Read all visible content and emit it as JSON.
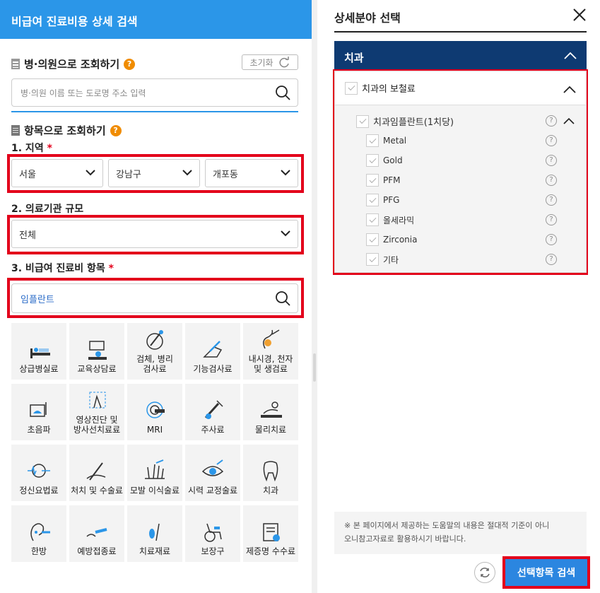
{
  "left": {
    "header_title": "비급여 진료비용 상세 검색",
    "hospital_search": {
      "title": "병·의원으로 조회하기",
      "help": "?",
      "reset_label": "초기화",
      "placeholder": "병·의원 이름 또는 도로명 주소 입력"
    },
    "item_search": {
      "title": "항목으로 조회하기",
      "help": "?",
      "region": {
        "label": "1. 지역",
        "required": "*",
        "sido": "서울",
        "sigungu": "강남구",
        "dong": "개포동"
      },
      "scale": {
        "label": "2. 의료기관 규모",
        "value": "전체"
      },
      "item": {
        "label": "3. 비급여 진료비 항목",
        "required": "*",
        "value": "임플란트"
      }
    },
    "categories": [
      {
        "l1": "상급병실료",
        "l2": "",
        "icon": "hospital-bed-icon"
      },
      {
        "l1": "교육상담료",
        "l2": "",
        "icon": "consultation-icon"
      },
      {
        "l1": "검체, 병리",
        "l2": "검사료",
        "icon": "specimen-icon"
      },
      {
        "l1": "기능검사료",
        "l2": "",
        "icon": "function-test-icon"
      },
      {
        "l1": "내시경, 천자",
        "l2": "및 생검료",
        "icon": "endoscope-icon"
      },
      {
        "l1": "초음파",
        "l2": "",
        "icon": "ultrasound-icon"
      },
      {
        "l1": "영상진단 및",
        "l2": "방사선치료료",
        "icon": "xray-icon"
      },
      {
        "l1": "MRI",
        "l2": "",
        "icon": "mri-icon"
      },
      {
        "l1": "주사료",
        "l2": "",
        "icon": "syringe-icon"
      },
      {
        "l1": "물리치료",
        "l2": "",
        "icon": "physio-icon"
      },
      {
        "l1": "정신요법료",
        "l2": "",
        "icon": "brain-icon"
      },
      {
        "l1": "처치 및 수술료",
        "l2": "",
        "icon": "surgery-icon"
      },
      {
        "l1": "모발 이식술료",
        "l2": "",
        "icon": "hair-icon"
      },
      {
        "l1": "시력 교정술료",
        "l2": "",
        "icon": "eye-icon"
      },
      {
        "l1": "치과",
        "l2": "",
        "icon": "tooth-icon"
      },
      {
        "l1": "한방",
        "l2": "",
        "icon": "acupuncture-icon"
      },
      {
        "l1": "예방접종료",
        "l2": "",
        "icon": "vaccine-icon"
      },
      {
        "l1": "치료재료",
        "l2": "",
        "icon": "material-icon"
      },
      {
        "l1": "보장구",
        "l2": "",
        "icon": "wheelchair-icon"
      },
      {
        "l1": "제증명 수수료",
        "l2": "",
        "icon": "certificate-icon"
      }
    ]
  },
  "right": {
    "title": "상세분야 선택",
    "category": "치과",
    "tree": {
      "top": "치과의 보철료",
      "sub": "치과임플란트(1치당)",
      "items": [
        "Metal",
        "Gold",
        "PFM",
        "PFG",
        "올세라믹",
        "Zirconia",
        "기타"
      ]
    },
    "notice_line1": "※ 본 페이지에서 제공하는 도움말의 내용은 절대적 기준이 아니",
    "notice_line2": "오니참고자료로 활용하시기 바랍니다.",
    "search_button": "선택항목 검색",
    "help": "?"
  },
  "colors": {
    "header_blue": "#2b96e8",
    "navy": "#0e3a72",
    "highlight_red": "#e3001b",
    "orange_help": "#f08c00"
  }
}
